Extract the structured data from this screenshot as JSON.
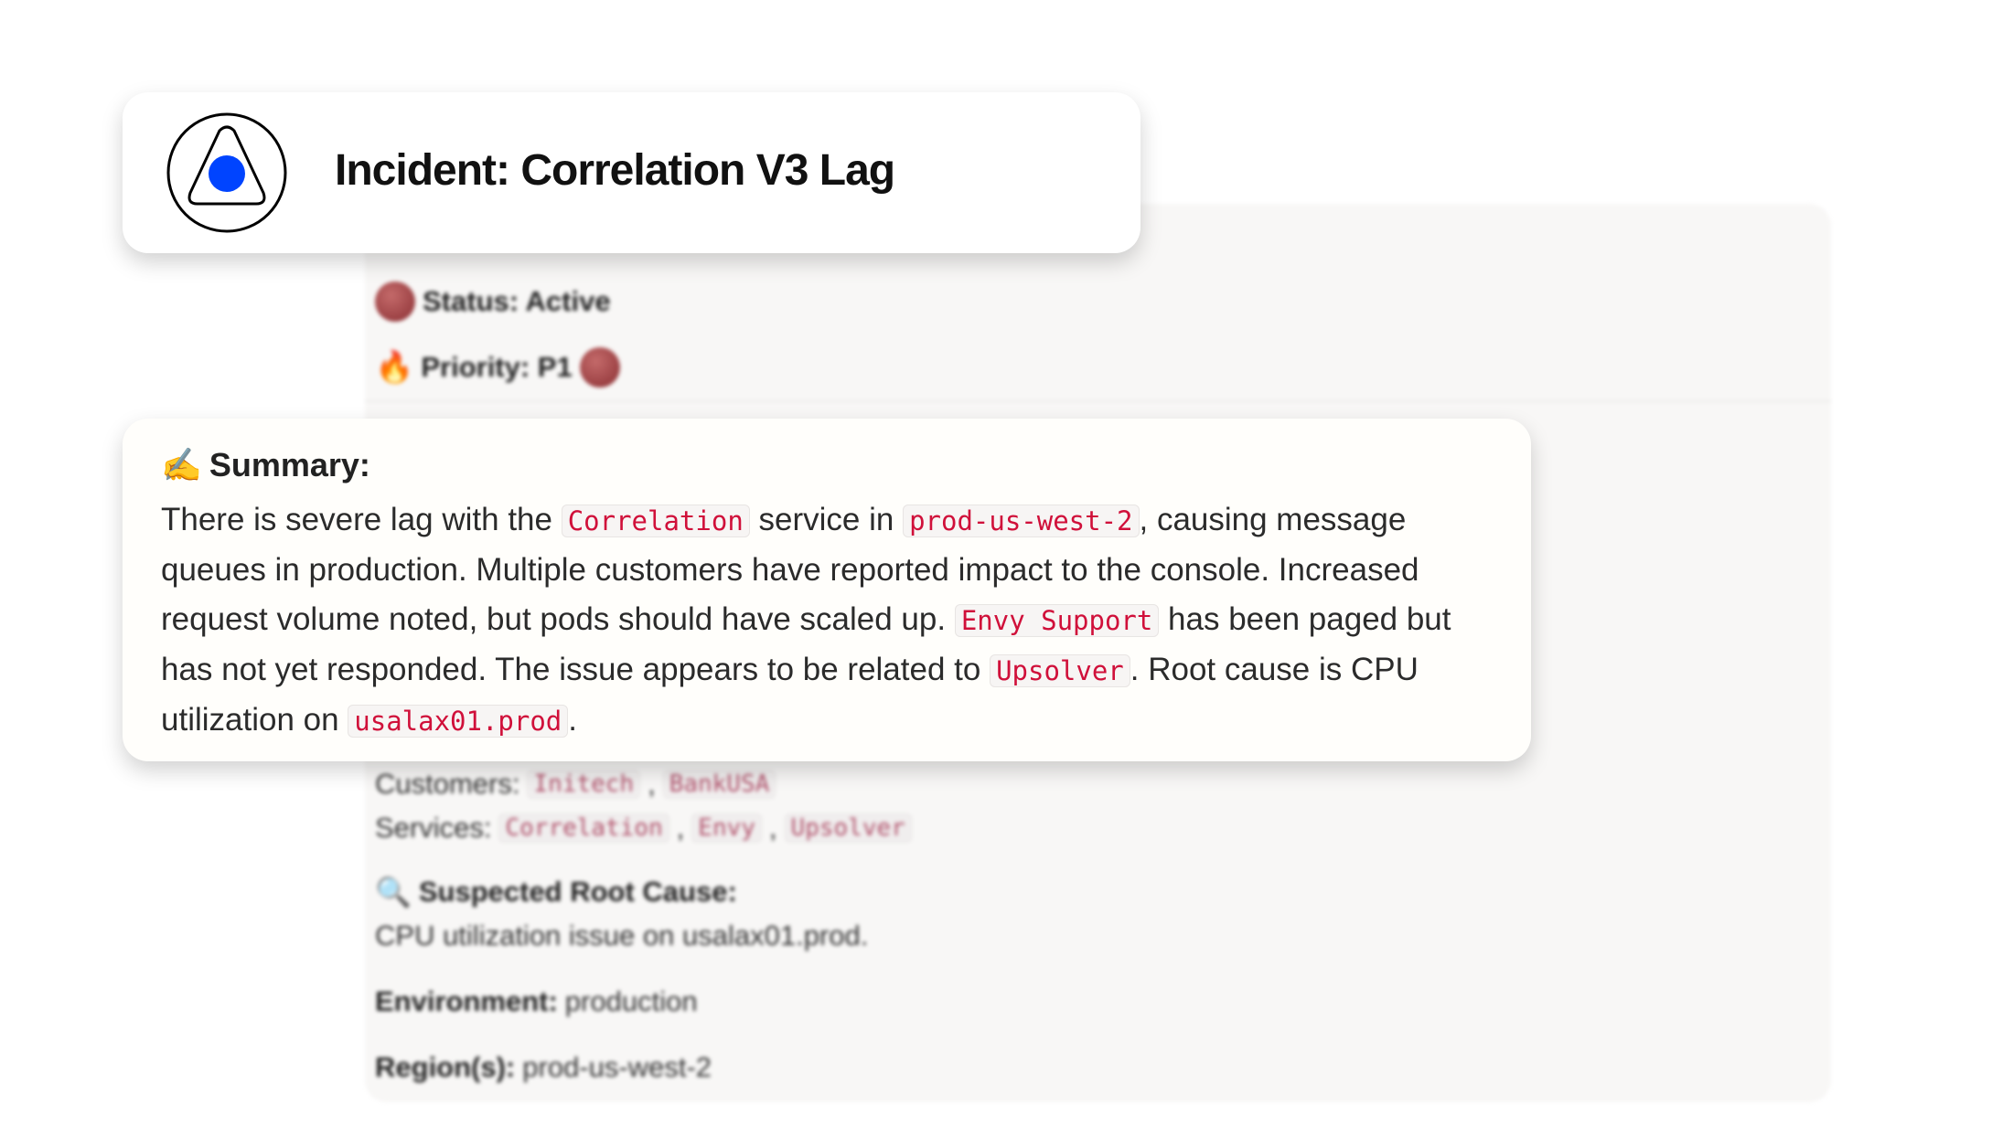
{
  "header": {
    "title": "Incident: Correlation V3 Lag",
    "logo_icon": "triangle-dot-logo",
    "logo_color": "#0044ff"
  },
  "background_panel": {
    "status": "Status: Active",
    "priority": "Priority: P1",
    "customers_label": "Customers:",
    "customers": [
      "Initech",
      "BankUSA"
    ],
    "services_label": "Services:",
    "services": [
      "Correlation",
      "Envy",
      "Upsolver"
    ],
    "root_cause_label": "Suspected Root Cause:",
    "root_cause": "CPU utilization issue on usalax01.prod.",
    "environment_label": "Environment:",
    "environment": "production",
    "regions_label": "Region(s):",
    "regions": "prod-us-west-2",
    "sep": ","
  },
  "summary": {
    "heading": "Summary:",
    "icon": "writing-hand-icon",
    "parts": [
      "There is severe lag with the ",
      "Correlation",
      " service in ",
      "prod-us-west-2",
      ", causing message queues in production. Multiple customers have reported impact to the console. Increased request volume noted, but pods should have scaled up. ",
      "Envy Support",
      " has been paged but has not yet responded. The issue appears to be related to ",
      "Upsolver",
      ". Root cause is CPU utilization on ",
      "usalax01.prod",
      "."
    ]
  },
  "colors": {
    "code_text": "#d0103a",
    "status_dot": "#8a2f33"
  }
}
